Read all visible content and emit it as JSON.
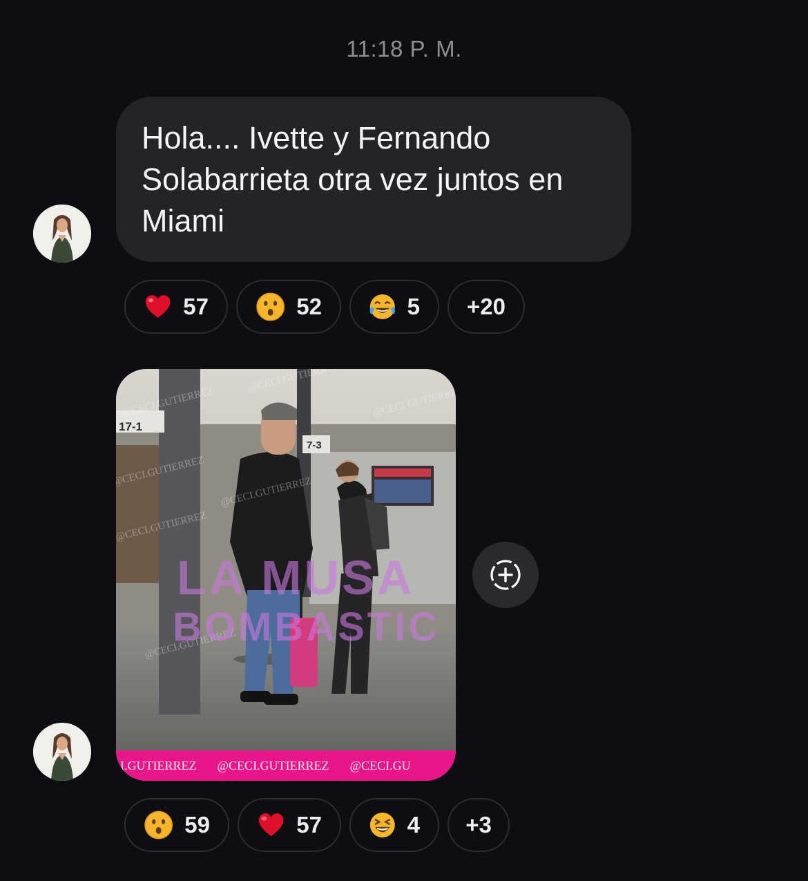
{
  "timestamp": "11:18 P. M.",
  "message1": {
    "text": "Hola.... Ivette y Fernando Solabarrieta otra vez juntos en Miami",
    "reactions": [
      {
        "emoji": "red-heart",
        "count": "57"
      },
      {
        "emoji": "hushed-face",
        "count": "52"
      },
      {
        "emoji": "face-with-tears-of-joy",
        "count": "5"
      },
      {
        "more": "+20"
      }
    ]
  },
  "message2": {
    "image": {
      "watermark": "@CECI.GUTIERREZ",
      "gate_labels": [
        "17-1",
        "7-3"
      ],
      "brand_line1": "LA MUSA",
      "brand_line2": "BOMBASTIC",
      "strip": [
        "I.GUTIERREZ",
        "@CECI.GUTIERREZ",
        "@CECI.GU"
      ]
    },
    "reactions": [
      {
        "emoji": "hushed-face",
        "count": "59"
      },
      {
        "emoji": "red-heart",
        "count": "57"
      },
      {
        "emoji": "grinning-squinting-face",
        "count": "4"
      },
      {
        "more": "+3"
      }
    ]
  },
  "colors": {
    "background": "#0d0e12",
    "bubble": "#232429",
    "accent_strip": "#e8168a"
  }
}
